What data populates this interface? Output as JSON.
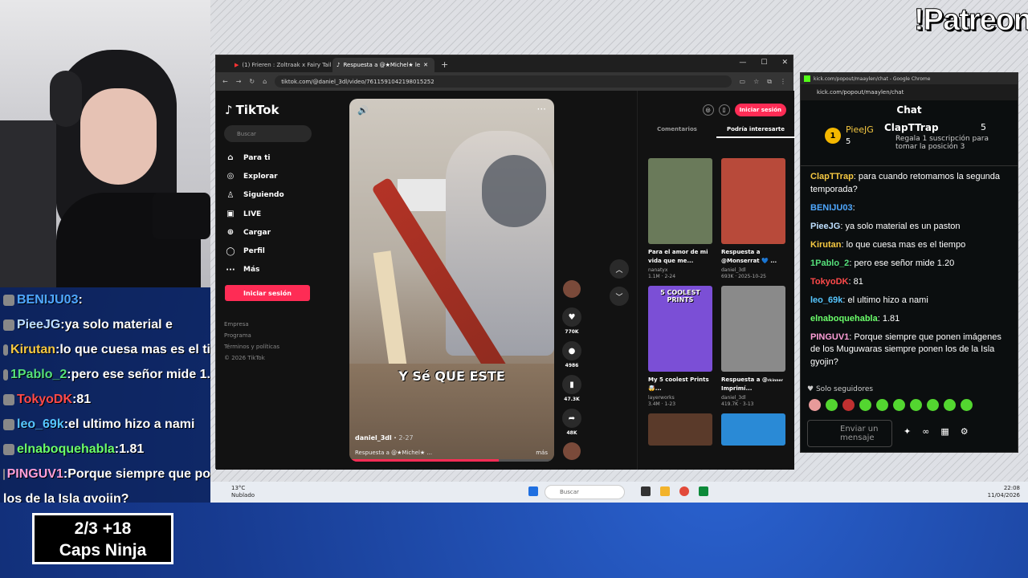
{
  "overlay": {
    "patreon": "!Patreon",
    "caps_line1": "2/3   +18",
    "caps_line2": "Caps Ninja"
  },
  "stream_chat": [
    {
      "user": "BENIJU03",
      "text": "",
      "ucolor": "#4fa8ff"
    },
    {
      "user": "PieeJG",
      "text": "ya solo material e",
      "ucolor": "#bfe0ff"
    },
    {
      "user": "Kirutan",
      "text": "lo que cuesa mas es el ti",
      "ucolor": "#f5c842"
    },
    {
      "user": "1Pablo_2",
      "text": "pero ese señor mide 1.",
      "ucolor": "#55e07a"
    },
    {
      "user": "TokyoDK",
      "text": "81",
      "ucolor": "#ff4a4a"
    },
    {
      "user": "leo_69k",
      "text": "el ultimo hizo a nami",
      "ucolor": "#56c6ff"
    },
    {
      "user": "elnaboquehabla",
      "text": "1.81",
      "ucolor": "#6bff6b"
    },
    {
      "user": "PINGUV1",
      "text": "Porque siempre que po",
      "ucolor": "#ff9fd8"
    },
    {
      "user": "",
      "text": "los de la Isla gyojin?",
      "ucolor": "#fff"
    }
  ],
  "browser": {
    "tabs": [
      {
        "label": "(1) Frieren : Zoltraak x Fairy Tail"
      },
      {
        "label": "Respuesta a @★Michel★ le"
      }
    ],
    "url": "tiktok.com/@daniel_3dl/video/7611591042198015252"
  },
  "tiktok": {
    "logo": "TikTok",
    "search_placeholder": "Buscar",
    "nav": [
      {
        "label": "Para ti",
        "icon": "⌂"
      },
      {
        "label": "Explorar",
        "icon": "◎"
      },
      {
        "label": "Siguiendo",
        "icon": "♙"
      },
      {
        "label": "LIVE",
        "icon": "▣"
      },
      {
        "label": "Cargar",
        "icon": "⊕"
      },
      {
        "label": "Perfil",
        "icon": "◯"
      },
      {
        "label": "Más",
        "icon": "···"
      }
    ],
    "login": "Iniciar sesión",
    "footer": [
      "Empresa",
      "Programa",
      "Términos y políticas",
      "© 2026 TikTok"
    ],
    "video": {
      "caption": "Y Sé QUE ESTE",
      "author": "daniel_3dl",
      "date": "2-27",
      "desc": "Respuesta a @★Michel★ ...",
      "more": "más",
      "progress": 0.73
    },
    "actions": {
      "likes": "770K",
      "comments": "4986",
      "saves": "47.3K",
      "shares": "48K"
    },
    "right": {
      "login": "Iniciar sesión",
      "tab_comments": "Comentarios",
      "tab_suggest": "Podría interesarte",
      "cards": [
        {
          "title": "Para el amor de mi vida que me...",
          "author": "nanatyx",
          "stats": "1.1M · 2-24",
          "bg": "#6a7a5a"
        },
        {
          "title": "Respuesta a @Monserrat 💙 ...",
          "author": "daniel_3dl",
          "stats": "693K · 2025-10-25",
          "bg": "#b84a3a"
        },
        {
          "title": "My 5 coolest Prints🤯...",
          "author": "layerworks",
          "stats": "3.4M · 1-23",
          "bg": "#7b4fd6",
          "badge": "5 COOLEST PRINTS"
        },
        {
          "title": "Respuesta a @ᵣₖᵢₙₙₑᵣ Imprimí...",
          "author": "daniel_3dl",
          "stats": "419.7K · 3-13",
          "bg": "#8a8a8a"
        },
        {
          "title": "",
          "author": "",
          "stats": "",
          "bg": "#5a3a2a"
        },
        {
          "title": "",
          "author": "",
          "stats": "",
          "bg": "#2a8ad6"
        }
      ]
    }
  },
  "kick": {
    "window_title": "kick.com/popout/maaylen/chat - Google Chrome",
    "url": "kick.com/popout/maaylen/chat",
    "header": "Chat",
    "pinned": {
      "rank": "1",
      "user1": "PieeJG",
      "count1": "5",
      "user2": "ClapTTrap",
      "count2": "5",
      "sub": "Regala 1 suscripción para tomar la posición 3"
    },
    "messages": [
      {
        "user": "ClapTTrap",
        "text": "para cuando retomamos la segunda temporada?",
        "color": "#f5c842"
      },
      {
        "user": "BENIJU03",
        "text": "",
        "color": "#4fa8ff"
      },
      {
        "user": "PieeJG",
        "text": "ya solo material es un paston",
        "color": "#bfe0ff"
      },
      {
        "user": "Kirutan",
        "text": "lo que cuesa mas es el tiempo",
        "color": "#f5c842"
      },
      {
        "user": "1Pablo_2",
        "text": "pero ese señor mide 1.20",
        "color": "#55e07a"
      },
      {
        "user": "TokyoDK",
        "text": "81",
        "color": "#ff4a4a"
      },
      {
        "user": "leo_69k",
        "text": "el ultimo hizo a nami",
        "color": "#56c6ff"
      },
      {
        "user": "elnaboquehabla",
        "text": "1.81",
        "color": "#6bff6b"
      },
      {
        "user": "PINGUV1",
        "text": "Porque siempre que ponen imágenes de los Muguwaras siempre ponen los de la Isla gyojin?",
        "color": "#ff9fd8"
      }
    ],
    "followers_only": "Solo seguidores",
    "input_placeholder": "Enviar un mensaje"
  },
  "taskbar": {
    "temp": "13°C",
    "weather": "Nublado",
    "search": "Buscar",
    "time": "22:08",
    "date": "11/04/2026"
  }
}
